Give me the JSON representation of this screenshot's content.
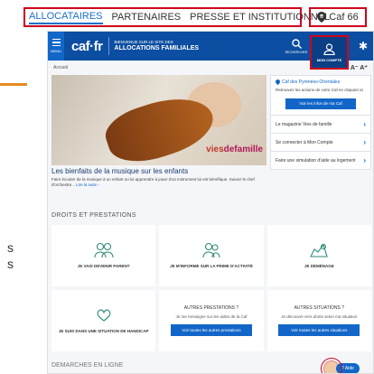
{
  "tabs": [
    "ALLOCATAIRES",
    "PARTENAIRES",
    "PRESSE ET INSTITUTIONNEL"
  ],
  "caf_location": "Caf 66",
  "side_letters": [
    "s",
    "s"
  ],
  "header": {
    "menu_label": "MENU",
    "logo": "caf·fr",
    "welcome": "BIENVENUE SUR LE SITE DES",
    "brand": "ALLOCATIONS FAMILIALES",
    "search_label": "RECHERCHER",
    "account_label": "MON COMPTE"
  },
  "breadcrumb": "Accueil",
  "font_size_controls": "A⁻ A⁺",
  "hero": {
    "brand_left": "vies",
    "brand_right": "defamille",
    "title": "Les bienfaits de la musique sur les enfants",
    "text": "Faire écouter de la musique à un enfant ou lui apprendre à jouer d'un instrument lui est bénéfique. Suivez le chef d'orchestre...",
    "link": "Lire la suite ›"
  },
  "sidebar": {
    "card_title": "Caf des Pyrénées-Orientales",
    "card_desc": "Retrouvez les actions de votre Caf en cliquant ici",
    "card_button": "Voir les infos de ma Caf",
    "links": [
      "Le magazine Vies de famille",
      "Se connecter à Mon Compte",
      "Faire une simulation d'aide au logement"
    ]
  },
  "section_title": "DROITS ET PRESTATIONS",
  "tiles_row1": [
    {
      "label": "JE VAIS DEVENIR PARENT"
    },
    {
      "label": "JE M'INFORME SUR LA PRIME D'ACTIVITÉ"
    },
    {
      "label": "JE DÉMÉNAGE"
    }
  ],
  "tiles_row2": {
    "handicap": "JE SUIS DANS UNE SITUATION DE HANDICAP",
    "other_prest_title": "AUTRES PRESTATIONS ?",
    "other_prest_desc": "Je me renseigne sur les aides de la Caf",
    "other_prest_button": "Voir toutes les autres prestations",
    "other_sit_title": "AUTRES SITUATIONS ?",
    "other_sit_desc": "Je découvre vers droits selon ma situation",
    "other_sit_button": "Voir toutes les autres situations"
  },
  "bottom_section": "DEMARCHES EN LIGNE",
  "help_label": "Aide",
  "colors": {
    "primary": "#0c4ea1",
    "accent": "#1266c8",
    "highlight": "#d0021b",
    "orange": "#e78a22"
  }
}
